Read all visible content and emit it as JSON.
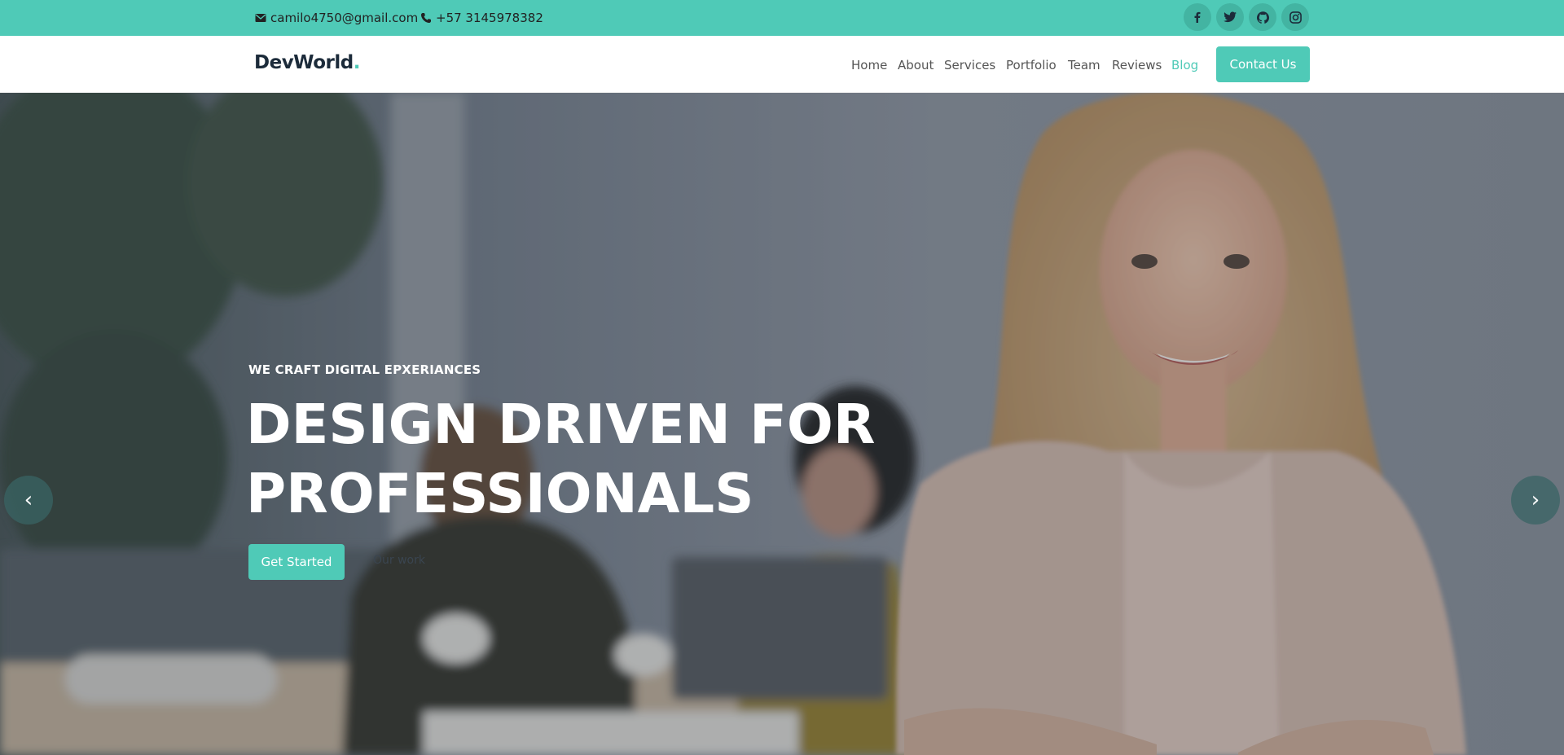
{
  "topbar": {
    "email": "camilo4750@gmail.com",
    "phone": "+57 3145978382",
    "social_icons": [
      "facebook-icon",
      "twitter-icon",
      "github-icon",
      "instagram-icon"
    ]
  },
  "header": {
    "logo_text": "DevWorld",
    "logo_dot": ".",
    "nav": [
      "Home",
      "About",
      "Services",
      "Portfolio",
      "Team",
      "Reviews",
      "Blog"
    ],
    "active_nav": "Blog",
    "contact_button": "Contact Us"
  },
  "hero": {
    "tagline": "WE CRAFT DIGITAL EPXERIANCES",
    "headline_line1": "DESIGN DRIVEN FOR",
    "headline_line2": "PROFESSIONALS",
    "primary_button": "Get Started",
    "secondary_link": "Our work",
    "prev_arrow": "‹",
    "next_arrow": "›"
  },
  "colors": {
    "accent": "#4fcab7",
    "dark": "#1c2b3a"
  }
}
